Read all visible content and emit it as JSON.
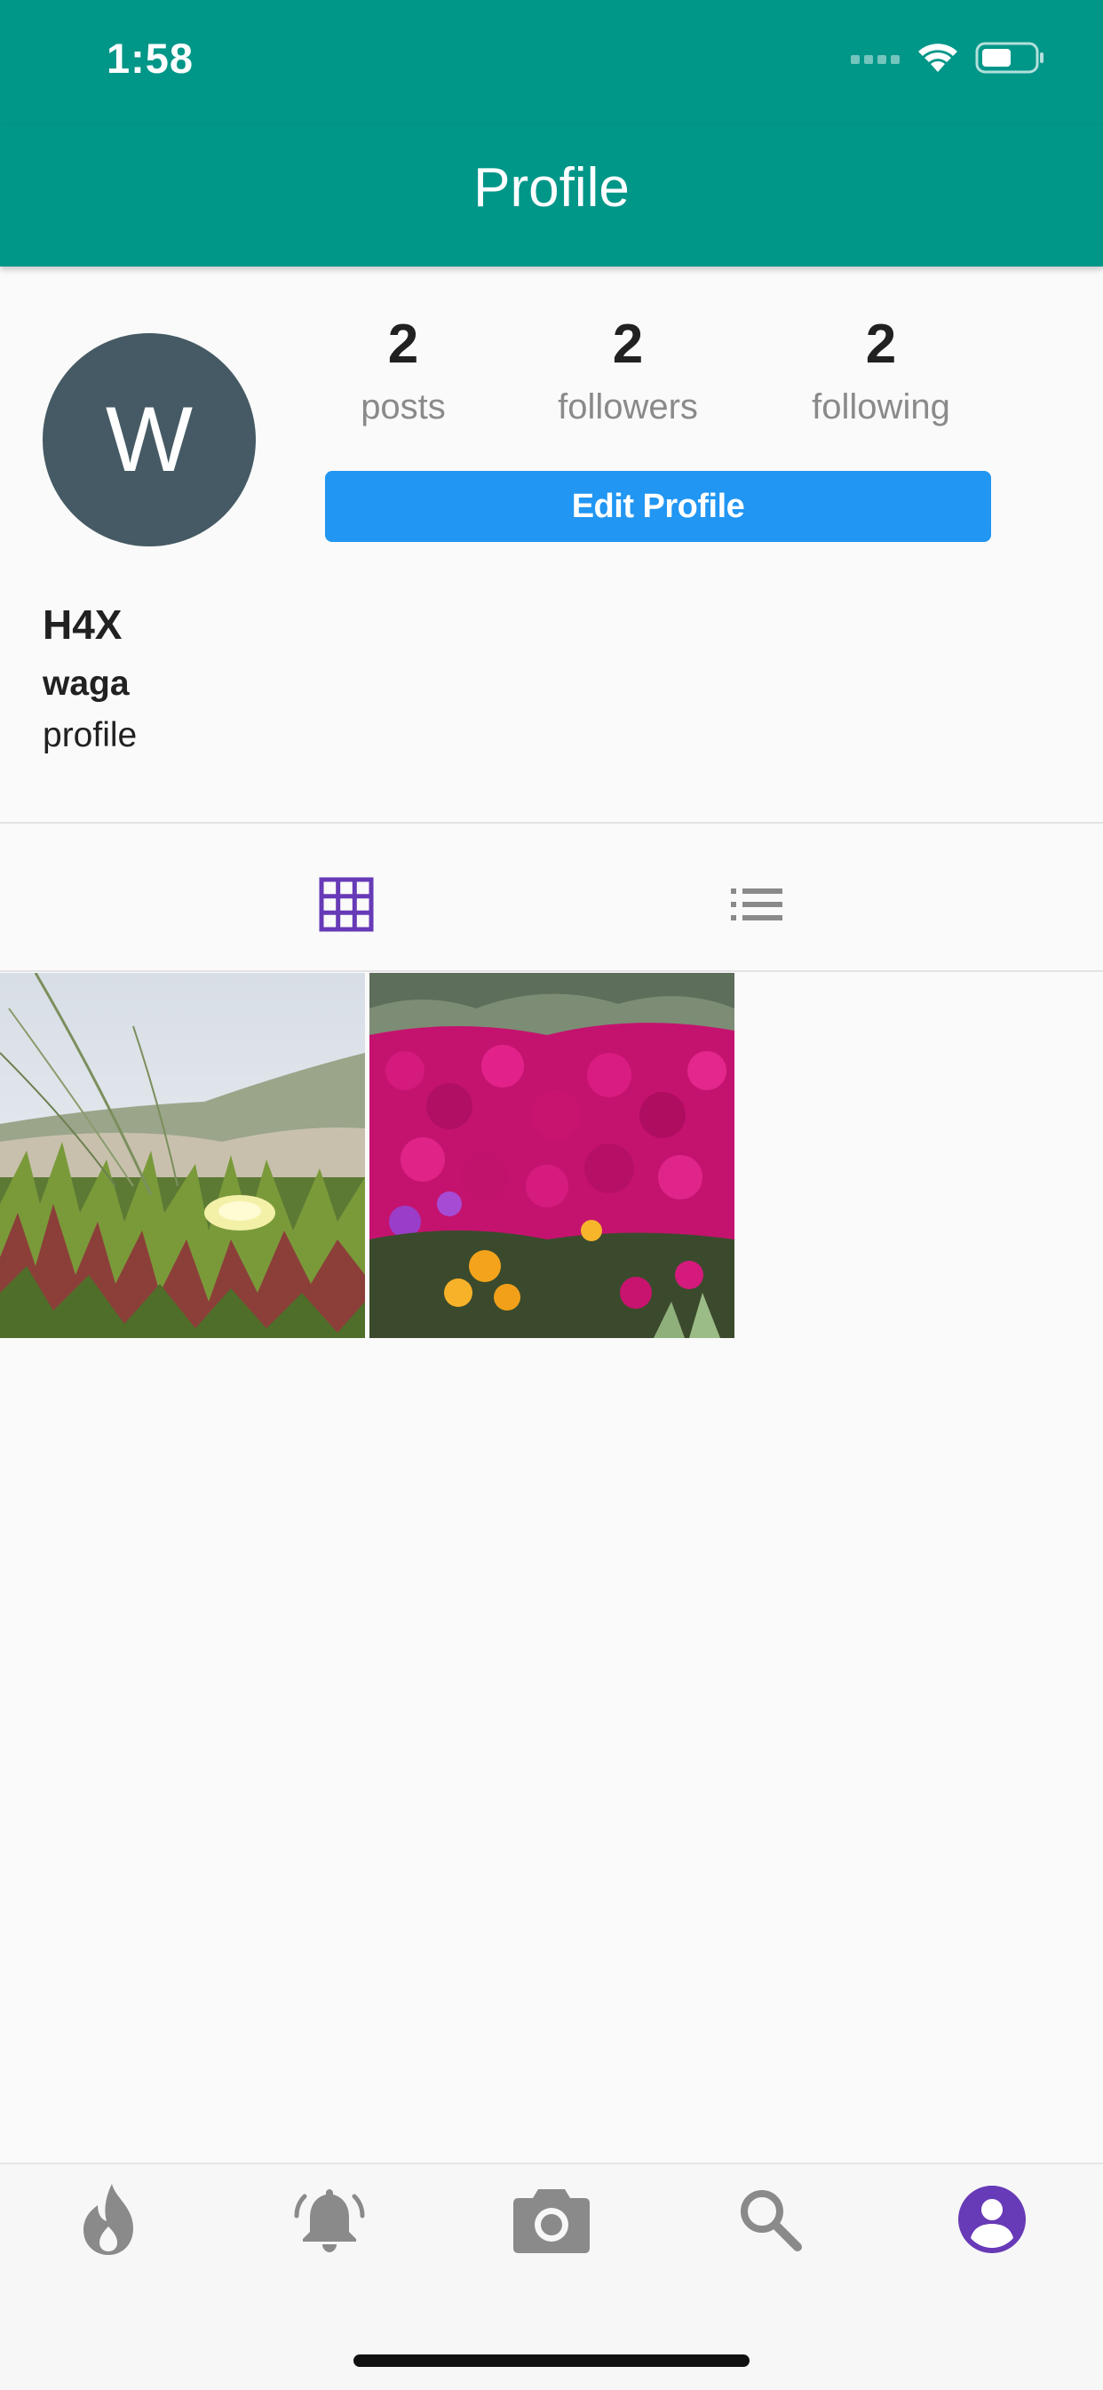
{
  "status_bar": {
    "time": "1:58"
  },
  "header": {
    "title": "Profile"
  },
  "profile": {
    "avatar_initial": "W",
    "display_name": "H4X",
    "username": "waga",
    "bio": "profile",
    "stats": {
      "posts": {
        "count": "2",
        "label": "posts"
      },
      "followers": {
        "count": "2",
        "label": "followers"
      },
      "following": {
        "count": "2",
        "label": "following"
      }
    },
    "edit_button_label": "Edit Profile"
  },
  "view_toggle": {
    "active": "grid",
    "options": [
      "grid-view-icon",
      "list-view-icon"
    ]
  },
  "photos": [
    {
      "name": "photo-dune-flower"
    },
    {
      "name": "photo-magenta-flowers"
    }
  ],
  "tabbar": {
    "items": [
      "flame-icon",
      "bell-icon",
      "camera-icon",
      "search-icon",
      "account-icon"
    ],
    "active": "account-icon"
  },
  "colors": {
    "header": "#009688",
    "avatar": "#455a64",
    "button": "#2196f3",
    "active": "#673ab7",
    "inactive": "#8a8a8a"
  }
}
